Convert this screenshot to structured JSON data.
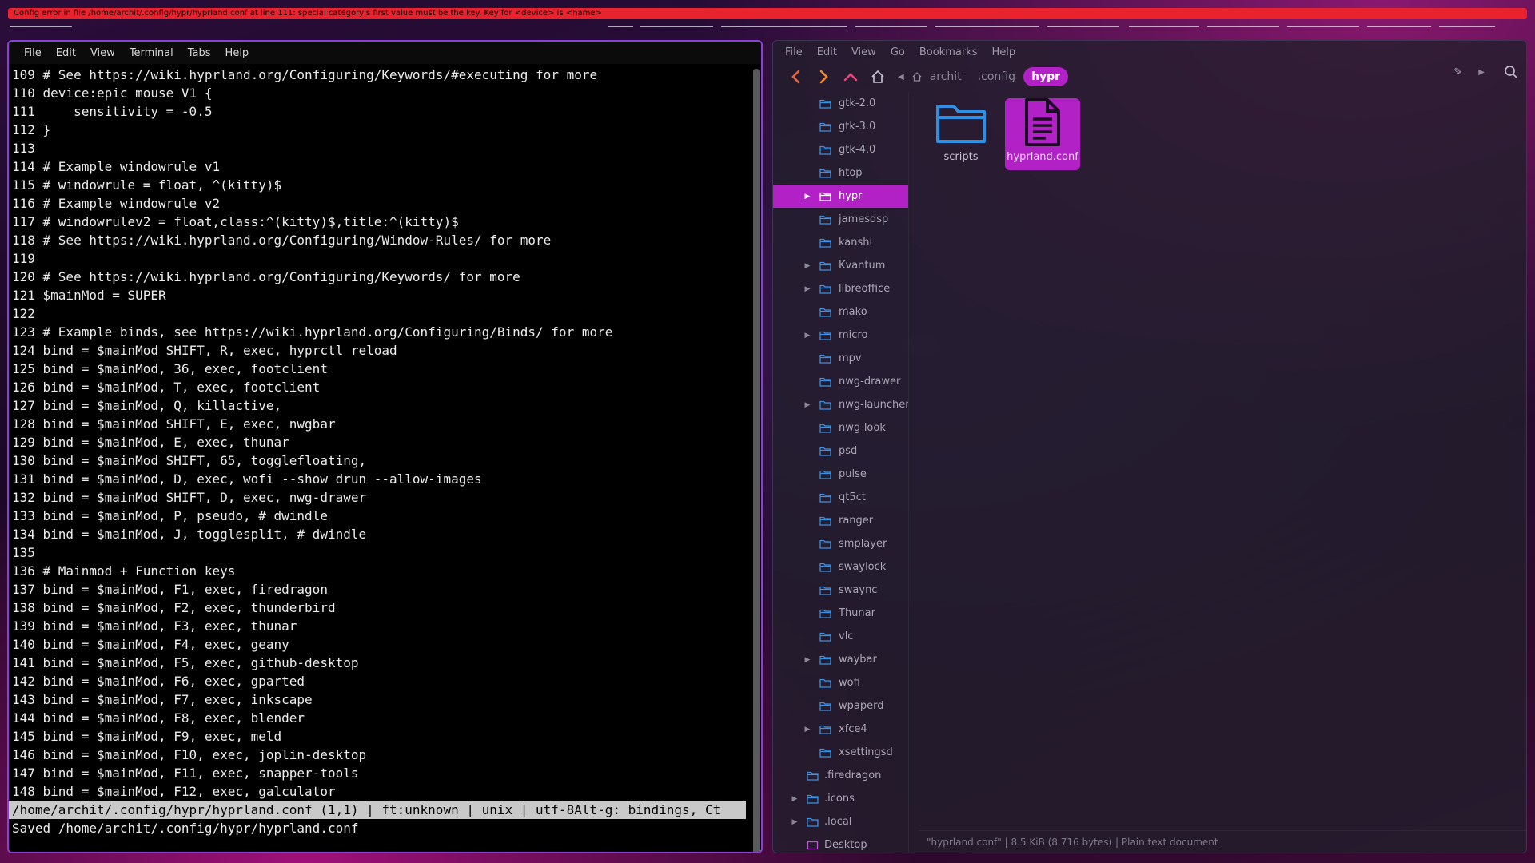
{
  "error_bar": {
    "text": "Config error in file /home/archit/.config/hypr/hyprland.conf at line 111: special category's first value must be the key. Key for <device> is <name>"
  },
  "terminal": {
    "menu": [
      "File",
      "Edit",
      "View",
      "Terminal",
      "Tabs",
      "Help"
    ],
    "lines": [
      "109 # See https://wiki.hyprland.org/Configuring/Keywords/#executing for more",
      "110 device:epic mouse V1 {",
      "111     sensitivity = -0.5",
      "112 }",
      "113",
      "114 # Example windowrule v1",
      "115 # windowrule = float, ^(kitty)$",
      "116 # Example windowrule v2",
      "117 # windowrulev2 = float,class:^(kitty)$,title:^(kitty)$",
      "118 # See https://wiki.hyprland.org/Configuring/Window-Rules/ for more",
      "119",
      "120 # See https://wiki.hyprland.org/Configuring/Keywords/ for more",
      "121 $mainMod = SUPER",
      "122",
      "123 # Example binds, see https://wiki.hyprland.org/Configuring/Binds/ for more",
      "124 bind = $mainMod SHIFT, R, exec, hyprctl reload",
      "125 bind = $mainMod, 36, exec, footclient",
      "126 bind = $mainMod, T, exec, footclient",
      "127 bind = $mainMod, Q, killactive,",
      "128 bind = $mainMod SHIFT, E, exec, nwgbar",
      "129 bind = $mainMod, E, exec, thunar",
      "130 bind = $mainMod SHIFT, 65, togglefloating,",
      "131 bind = $mainMod, D, exec, wofi --show drun --allow-images",
      "132 bind = $mainMod SHIFT, D, exec, nwg-drawer",
      "133 bind = $mainMod, P, pseudo, # dwindle",
      "134 bind = $mainMod, J, togglesplit, # dwindle",
      "135",
      "136 # Mainmod + Function keys",
      "137 bind = $mainMod, F1, exec, firedragon",
      "138 bind = $mainMod, F2, exec, thunderbird",
      "139 bind = $mainMod, F3, exec, thunar",
      "140 bind = $mainMod, F4, exec, geany",
      "141 bind = $mainMod, F5, exec, github-desktop",
      "142 bind = $mainMod, F6, exec, gparted",
      "143 bind = $mainMod, F7, exec, inkscape",
      "144 bind = $mainMod, F8, exec, blender",
      "145 bind = $mainMod, F9, exec, meld",
      "146 bind = $mainMod, F10, exec, joplin-desktop",
      "147 bind = $mainMod, F11, exec, snapper-tools",
      "148 bind = $mainMod, F12, exec, galculator"
    ],
    "status_line": "/home/archit/.config/hypr/hyprland.conf (1,1) | ft:unknown | unix | utf-8Alt-g: bindings, Ct",
    "message_line": "Saved /home/archit/.config/hypr/hyprland.conf"
  },
  "file_manager": {
    "menu": [
      "File",
      "Edit",
      "View",
      "Go",
      "Bookmarks",
      "Help"
    ],
    "breadcrumbs": [
      "archit",
      ".config",
      "hypr"
    ],
    "accent": "#b221c6",
    "tree": [
      {
        "label": "gtk-2.0",
        "expandable": false,
        "level": 2
      },
      {
        "label": "gtk-3.0",
        "expandable": false,
        "level": 2
      },
      {
        "label": "gtk-4.0",
        "expandable": false,
        "level": 2
      },
      {
        "label": "htop",
        "expandable": false,
        "level": 2
      },
      {
        "label": "hypr",
        "expandable": true,
        "level": 2,
        "selected": true
      },
      {
        "label": "jamesdsp",
        "expandable": false,
        "level": 2
      },
      {
        "label": "kanshi",
        "expandable": false,
        "level": 2
      },
      {
        "label": "Kvantum",
        "expandable": true,
        "level": 2
      },
      {
        "label": "libreoffice",
        "expandable": true,
        "level": 2
      },
      {
        "label": "mako",
        "expandable": false,
        "level": 2
      },
      {
        "label": "micro",
        "expandable": true,
        "level": 2
      },
      {
        "label": "mpv",
        "expandable": false,
        "level": 2
      },
      {
        "label": "nwg-drawer",
        "expandable": false,
        "level": 2
      },
      {
        "label": "nwg-launchers",
        "expandable": true,
        "level": 2
      },
      {
        "label": "nwg-look",
        "expandable": false,
        "level": 2
      },
      {
        "label": "psd",
        "expandable": false,
        "level": 2
      },
      {
        "label": "pulse",
        "expandable": false,
        "level": 2
      },
      {
        "label": "qt5ct",
        "expandable": false,
        "level": 2
      },
      {
        "label": "ranger",
        "expandable": false,
        "level": 2
      },
      {
        "label": "smplayer",
        "expandable": false,
        "level": 2
      },
      {
        "label": "swaylock",
        "expandable": false,
        "level": 2
      },
      {
        "label": "swaync",
        "expandable": false,
        "level": 2
      },
      {
        "label": "Thunar",
        "expandable": false,
        "level": 2
      },
      {
        "label": "vlc",
        "expandable": false,
        "level": 2
      },
      {
        "label": "waybar",
        "expandable": true,
        "level": 2
      },
      {
        "label": "wofi",
        "expandable": false,
        "level": 2
      },
      {
        "label": "wpaperd",
        "expandable": false,
        "level": 2
      },
      {
        "label": "xfce4",
        "expandable": true,
        "level": 2
      },
      {
        "label": "xsettingsd",
        "expandable": false,
        "level": 2
      },
      {
        "label": ".firedragon",
        "expandable": false,
        "level": 1
      },
      {
        "label": ".icons",
        "expandable": true,
        "level": 1
      },
      {
        "label": ".local",
        "expandable": true,
        "level": 1
      },
      {
        "label": "Desktop",
        "expandable": false,
        "level": 1,
        "icon": "desktop-icon"
      }
    ],
    "files": [
      {
        "name": "scripts",
        "icon": "folder-icon",
        "selected": false
      },
      {
        "name": "hyprland.conf",
        "icon": "text-file-icon",
        "selected": true
      }
    ],
    "status": "\"hyprland.conf\"  |  8.5 KiB (8,716 bytes)  |  Plain text document"
  }
}
